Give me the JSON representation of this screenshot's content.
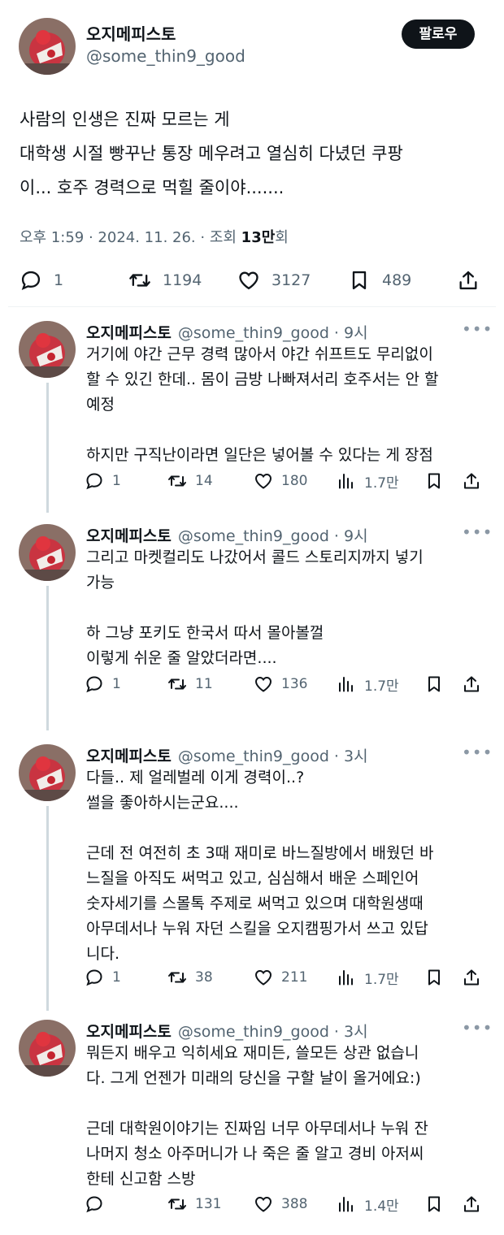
{
  "main": {
    "name": "오지메피스토",
    "handle": "@some_thin9_good",
    "follow_label": "팔로우",
    "text_lines": [
      "사람의 인생은 진짜 모르는 게",
      "대학생 시절 빵꾸난 통장 메우려고 열심히 다녔던 쿠팡",
      "이... 호주 경력으로 먹힐 줄이야......."
    ],
    "meta_prefix": "오후 1:59 · 2024. 11. 26. · 조회 ",
    "views": "13만",
    "meta_suffix": "회",
    "counts": {
      "replies": "1",
      "retweets": "1194",
      "likes": "3127",
      "bookmarks": "489"
    }
  },
  "replies": [
    {
      "name": "오지메피스토",
      "handle_time": "@some_thin9_good · 9시",
      "lines": [
        "거기에 야간 근무 경력 많아서 야간 쉬프트도 무리없이",
        "할 수 있긴 한데.. 몸이 금방 나빠져서리 호주서는 안 할",
        "예정",
        "",
        "하지만 구직난이라면 일단은 넣어볼 수 있다는 게 장점"
      ],
      "counts": {
        "replies": "1",
        "retweets": "14",
        "likes": "180",
        "views": "1.7만"
      }
    },
    {
      "name": "오지메피스토",
      "handle_time": "@some_thin9_good · 9시",
      "lines": [
        "그리고 마켓컬리도 나갔어서 콜드 스토리지까지 넣기",
        "가능",
        "",
        "하 그냥 포키도 한국서 따서 몰아볼껄",
        "이렇게 쉬운 줄 알았더라면...."
      ],
      "counts": {
        "replies": "1",
        "retweets": "11",
        "likes": "136",
        "views": "1.7만"
      }
    },
    {
      "name": "오지메피스토",
      "handle_time": "@some_thin9_good · 3시",
      "lines": [
        "다들.. 제 얼레벌레 이게 경력이..?",
        "썰을 좋아하시는군요....",
        "",
        "근데 전 여전히 초 3때 재미로 바느질방에서 배웠던 바",
        "느질을 아직도 써먹고 있고, 심심해서 배운 스페인어",
        "숫자세기를 스몰톡 주제로 써먹고 있으며 대학원생때",
        "아무데서나 누워 자던 스킬을 오지캠핑가서 쓰고 있답",
        "니다."
      ],
      "counts": {
        "replies": "1",
        "retweets": "38",
        "likes": "211",
        "views": "1.7만"
      }
    },
    {
      "name": "오지메피스토",
      "handle_time": "@some_thin9_good · 3시",
      "lines": [
        "뭐든지 배우고 익히세요 재미든, 쓸모든 상관 없습니",
        "다. 그게 언젠가 미래의 당신을 구할 날이 올거에요:)",
        "",
        "근데 대학원이야기는 진짜임 너무 아무데서나 누워 잔",
        "나머지 청소 아주머니가 나 죽은 줄 알고 경비 아저씨",
        "한테 신고함 스방"
      ],
      "counts": {
        "replies": "",
        "retweets": "131",
        "likes": "388",
        "views": "1.4만"
      }
    }
  ],
  "icons": {
    "reply": "reply-icon",
    "retweet": "retweet-icon",
    "like": "heart-icon",
    "views": "views-icon",
    "bookmark": "bookmark-icon",
    "share": "share-icon",
    "more": "more-icon",
    "avatar": "avatar-image"
  }
}
